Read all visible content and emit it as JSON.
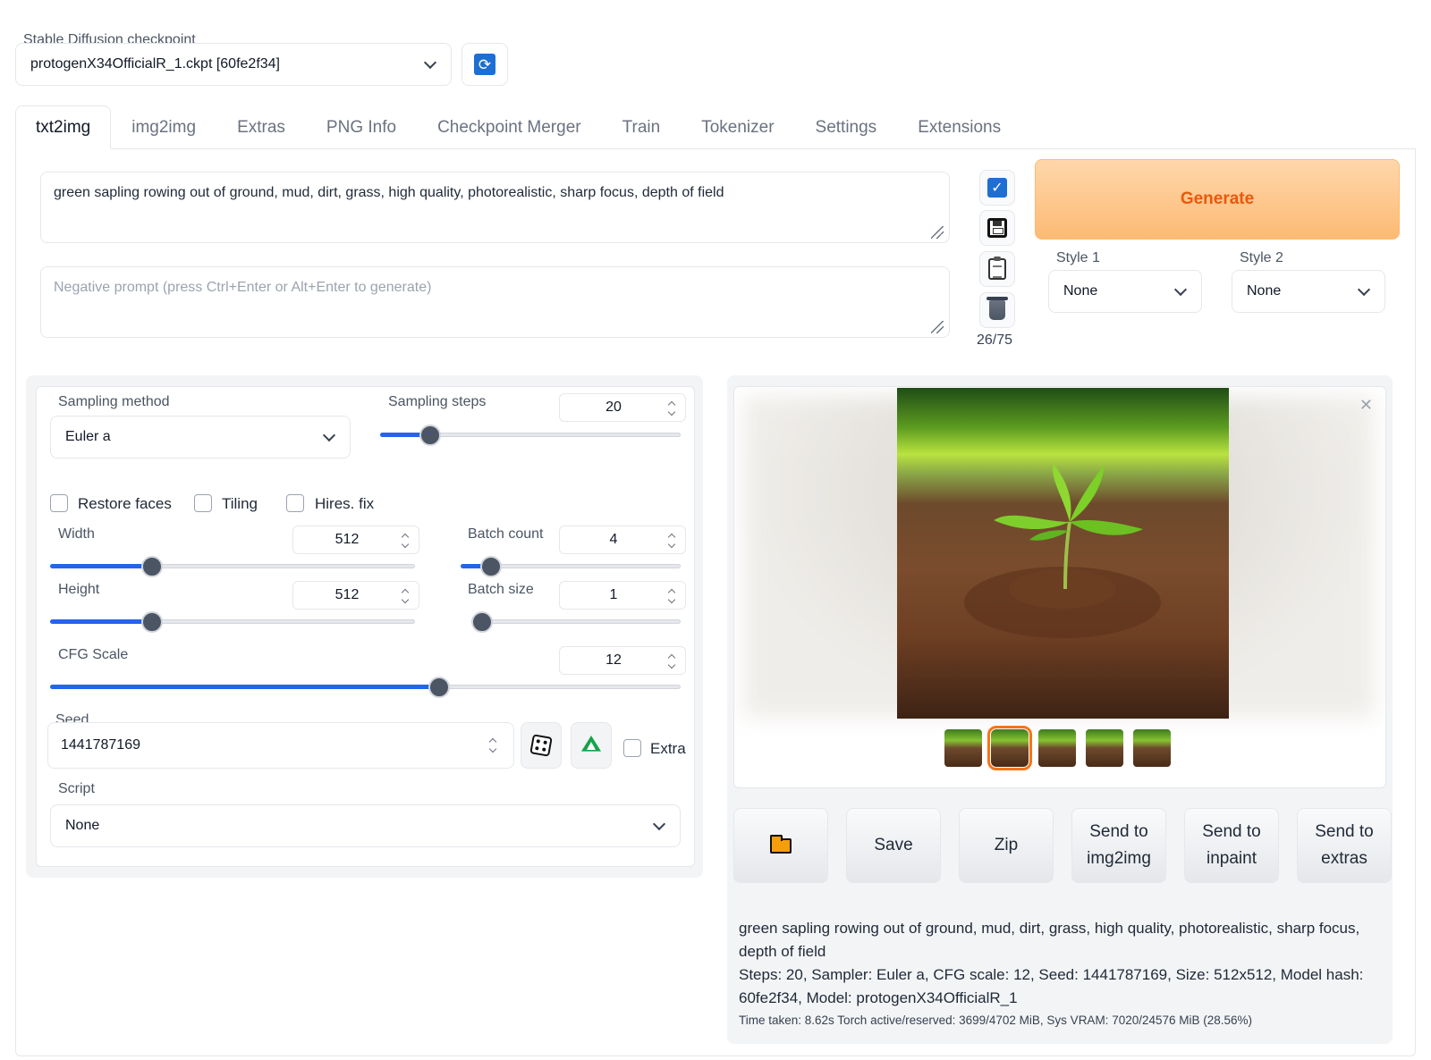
{
  "checkpoint": {
    "label": "Stable Diffusion checkpoint",
    "value": "protogenX34OfficialR_1.ckpt [60fe2f34]"
  },
  "tabs": [
    {
      "label": "txt2img",
      "active": true
    },
    {
      "label": "img2img"
    },
    {
      "label": "Extras"
    },
    {
      "label": "PNG Info"
    },
    {
      "label": "Checkpoint Merger"
    },
    {
      "label": "Train"
    },
    {
      "label": "Tokenizer"
    },
    {
      "label": "Settings"
    },
    {
      "label": "Extensions"
    }
  ],
  "prompt": {
    "value": "green sapling rowing out of ground, mud, dirt, grass, high quality, photorealistic, sharp focus, depth of field",
    "negative_placeholder": "Negative prompt (press Ctrl+Enter or Alt+Enter to generate)",
    "token_count": "26/75"
  },
  "generate": {
    "label": "Generate",
    "style1_label": "Style 1",
    "style1_value": "None",
    "style2_label": "Style 2",
    "style2_value": "None"
  },
  "settings": {
    "sampling_method_label": "Sampling method",
    "sampling_method_value": "Euler a",
    "sampling_steps_label": "Sampling steps",
    "sampling_steps_value": "20",
    "sampling_steps_fraction": 0.13,
    "restore_faces_label": "Restore faces",
    "tiling_label": "Tiling",
    "hires_label": "Hires. fix",
    "width_label": "Width",
    "width_value": "512",
    "width_fraction": 0.25,
    "height_label": "Height",
    "height_value": "512",
    "height_fraction": 0.25,
    "batch_count_label": "Batch count",
    "batch_count_value": "4",
    "batch_count_fraction": 0.09,
    "batch_size_label": "Batch size",
    "batch_size_value": "1",
    "batch_size_fraction": 0.0,
    "cfg_label": "CFG Scale",
    "cfg_value": "12",
    "cfg_fraction": 0.6,
    "seed_label": "Seed",
    "seed_value": "1441787169",
    "extra_label": "Extra",
    "script_label": "Script",
    "script_value": "None"
  },
  "actions": {
    "save": "Save",
    "zip": "Zip",
    "send_img2img_1": "Send to",
    "send_img2img_2": "img2img",
    "send_inpaint_1": "Send to",
    "send_inpaint_2": "inpaint",
    "send_extras_1": "Send to",
    "send_extras_2": "extras"
  },
  "info": {
    "line1": "green sapling rowing out of ground, mud, dirt, grass, high quality, photorealistic, sharp focus, depth of field",
    "line2": "Steps: 20, Sampler: Euler a, CFG scale: 12, Seed: 1441787169, Size: 512x512, Model hash: 60fe2f34, Model: protogenX34OfficialR_1",
    "time": "Time taken: 8.62s  Torch active/reserved: 3699/4702 MiB, Sys VRAM: 7020/24576 MiB (28.56%)"
  },
  "colors": {
    "accent": "#2563eb",
    "generate_text": "#ea580c",
    "generate_bg": "#fdba74",
    "selected_thumb": "#f97316"
  },
  "icons": [
    "refresh-icon",
    "check-icon",
    "save-icon",
    "clipboard-icon",
    "trash-icon",
    "dice-icon",
    "recycle-icon",
    "folder-icon",
    "close-icon"
  ]
}
